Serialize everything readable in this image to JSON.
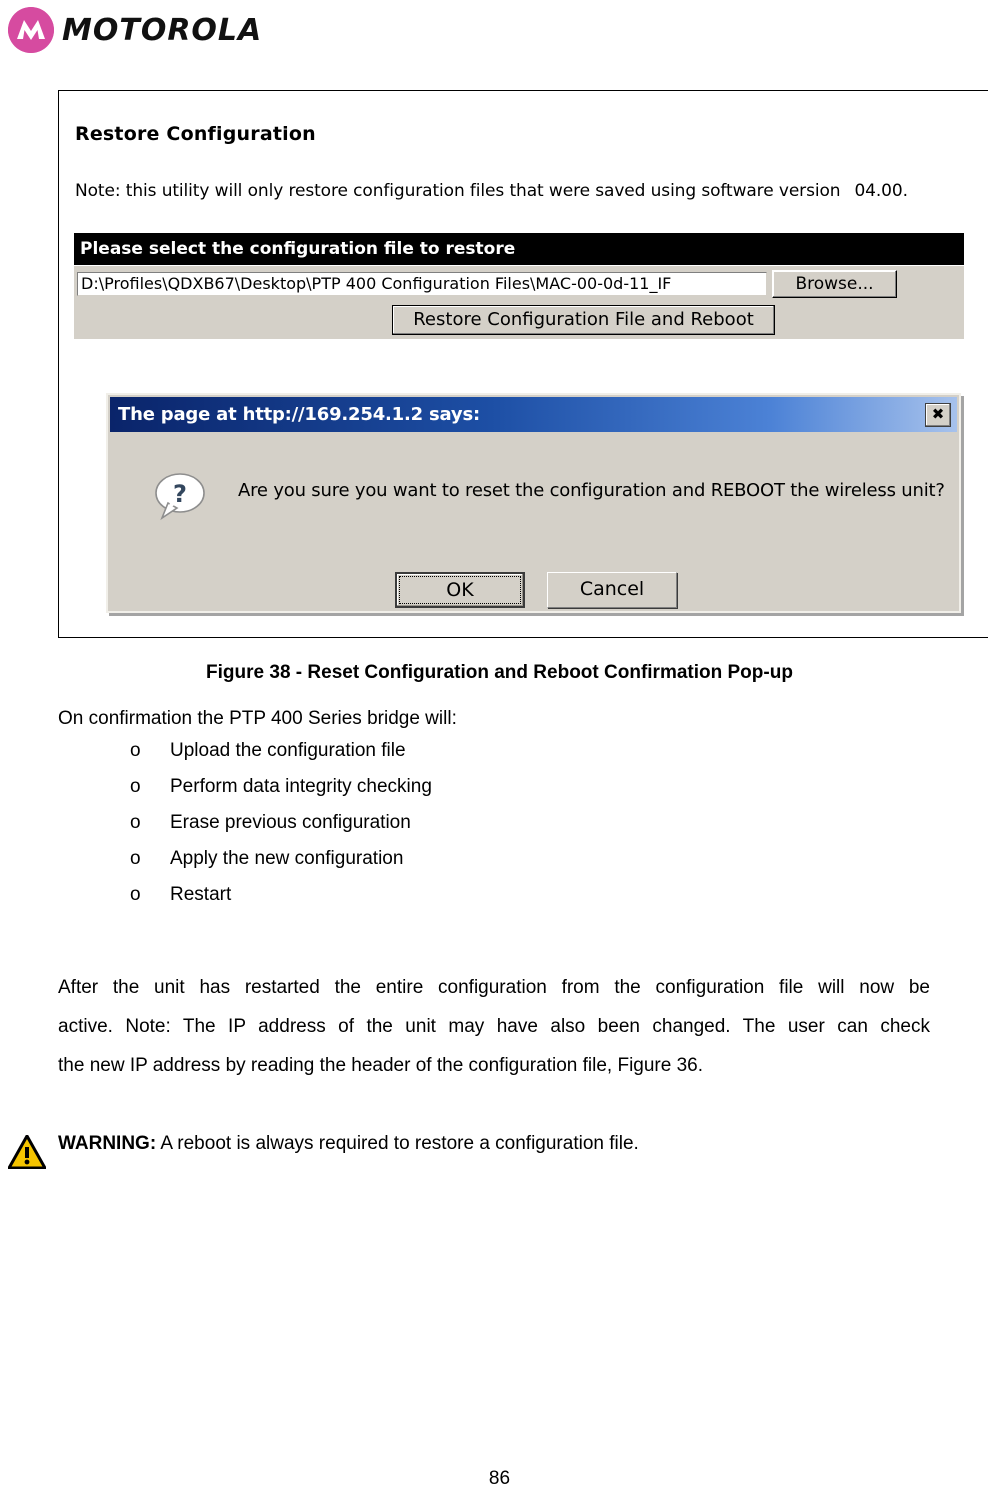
{
  "header": {
    "brand": "MOTOROLA",
    "logo_color": "#d64ba0"
  },
  "figure": {
    "screenshot": {
      "title": "Restore Configuration",
      "note": "Note: this utility will only restore configuration files that were saved using software version",
      "software_version": "04.00.",
      "section_bar": "Please select the configuration file to restore",
      "file_path_value": "D:\\Profiles\\QDXB67\\Desktop\\PTP 400 Configuration Files\\MAC-00-0d-11_IF",
      "browse_label": "Browse...",
      "restore_label": "Restore Configuration File and Reboot"
    },
    "dialog": {
      "title": "The page at http://169.254.1.2 says:",
      "close_glyph": "✖",
      "icon": "question-bubble-icon",
      "message": "Are you sure you want to reset the configuration and REBOOT the wireless unit?",
      "ok_label": "OK",
      "cancel_label": "Cancel",
      "titlebar_color": "#0a246a"
    },
    "caption": "Figure 38 - Reset Configuration and Reboot Confirmation Pop-up"
  },
  "body": {
    "lead": "On confirmation the PTP 400 Series bridge will:",
    "bullet_mark": "o",
    "bullets": [
      "Upload the configuration file",
      "Perform data integrity checking",
      "Erase previous configuration",
      "Apply the new configuration",
      "Restart"
    ],
    "paragraph_lines": [
      "After the unit has restarted the entire configuration from the configuration file will now be",
      "active. Note: The IP address of the unit may have also been changed. The user can check",
      "the new IP address by reading the header of the configuration file, Figure 36."
    ],
    "warning_label": "WARNING:",
    "warning_text": " A reboot is always required to restore a configuration file.",
    "warning_icon_color": "#f5c400"
  },
  "footer": {
    "page_number": "86"
  }
}
